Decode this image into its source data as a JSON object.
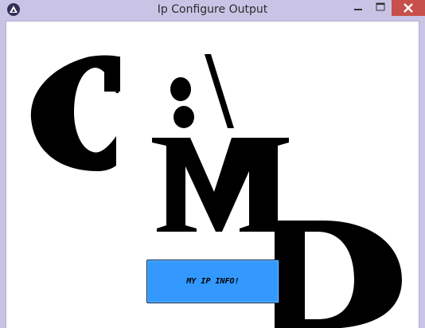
{
  "window": {
    "title": "Ip Configure Output",
    "icon": "app-triangle-icon",
    "controls": [
      "minimize-icon",
      "maximize-icon",
      "close-icon"
    ],
    "colors": {
      "titlebar": "#c9c4e6",
      "close": "#c7504a",
      "client": "#ffffff"
    }
  },
  "logo": {
    "text": "C:\\MD",
    "color": "#000000"
  },
  "button": {
    "label": "MY IP INFO!",
    "color": "#3399ff"
  }
}
